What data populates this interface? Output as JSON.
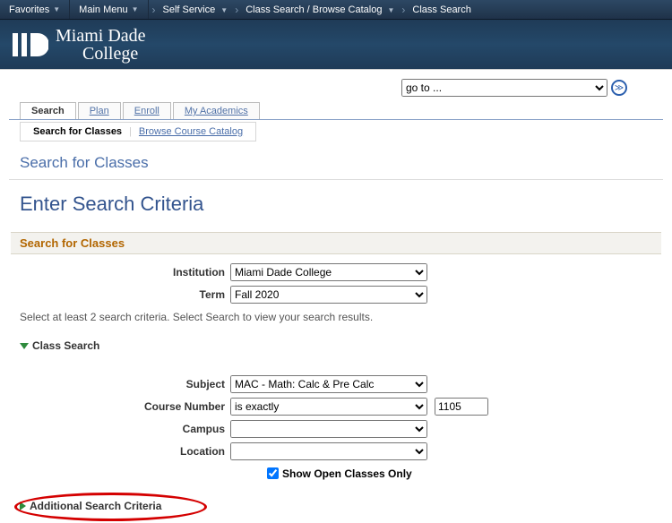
{
  "topnav": {
    "favorites": "Favorites",
    "mainmenu": "Main Menu",
    "breadcrumb": [
      "Self Service",
      "Class Search / Browse Catalog",
      "Class Search"
    ]
  },
  "banner": {
    "line1": "Miami Dade",
    "line2": "College"
  },
  "goto": {
    "placeholder": "go to ..."
  },
  "tabs": {
    "search": "Search",
    "plan": "Plan",
    "enroll": "Enroll",
    "academics": "My Academics"
  },
  "subtabs": {
    "search_classes": "Search for Classes",
    "browse_catalog": "Browse Course Catalog"
  },
  "titles": {
    "page": "Search for Classes",
    "sub": "Enter Search Criteria"
  },
  "section": {
    "header": "Search for Classes"
  },
  "form": {
    "institution_label": "Institution",
    "institution_value": "Miami Dade College",
    "term_label": "Term",
    "term_value": "Fall 2020",
    "hint": "Select at least 2 search criteria. Select Search to view your search results.",
    "class_search_header": "Class Search",
    "subject_label": "Subject",
    "subject_value": "MAC - Math: Calc & Pre Calc",
    "course_number_label": "Course Number",
    "course_number_op": "is exactly",
    "course_number_value": "1105",
    "campus_label": "Campus",
    "campus_value": "",
    "location_label": "Location",
    "location_value": "",
    "open_only_label": "Show Open Classes Only",
    "open_only_checked": true,
    "additional_header": "Additional Search Criteria"
  }
}
